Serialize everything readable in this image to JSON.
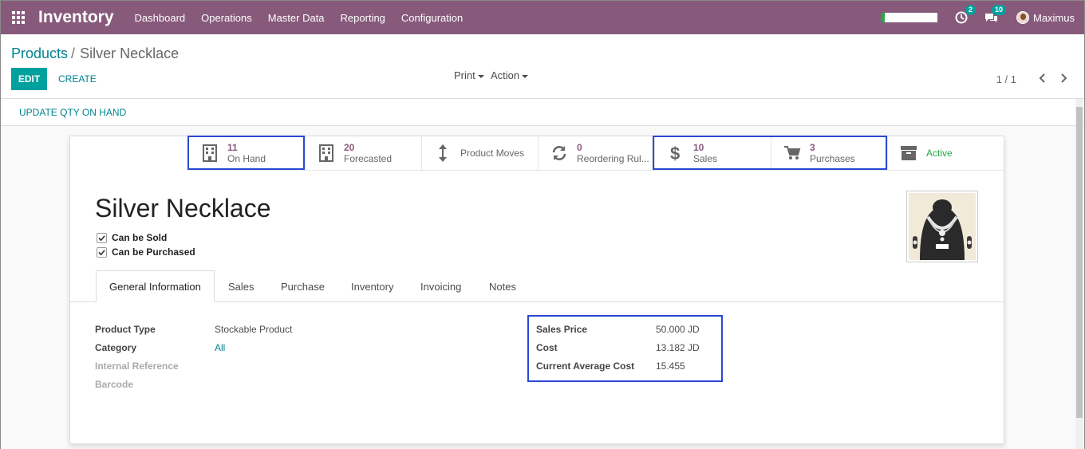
{
  "navbar": {
    "brand": "Inventory",
    "menu": [
      "Dashboard",
      "Operations",
      "Master Data",
      "Reporting",
      "Configuration"
    ],
    "activity_badge": "2",
    "messages_badge": "10",
    "user_name": "Maximus"
  },
  "breadcrumb": {
    "parent": "Products",
    "separator": "/",
    "current": "Silver Necklace"
  },
  "buttons": {
    "edit": "EDIT",
    "create": "CREATE",
    "print": "Print",
    "action": "Action",
    "update_qty": "UPDATE QTY ON HAND"
  },
  "pager": {
    "value": "1 / 1"
  },
  "smart_buttons": {
    "on_hand": {
      "value": "11",
      "label": "On Hand"
    },
    "forecasted": {
      "value": "20",
      "label": "Forecasted"
    },
    "product_moves": {
      "label": "Product Moves"
    },
    "reordering": {
      "value": "0",
      "label": "Reordering Rul..."
    },
    "sales": {
      "value": "10",
      "label": "Sales"
    },
    "purchases": {
      "value": "3",
      "label": "Purchases"
    },
    "active": {
      "label": "Active"
    }
  },
  "product": {
    "name": "Silver Necklace",
    "can_be_sold_label": "Can be Sold",
    "can_be_purchased_label": "Can be Purchased"
  },
  "tabs": [
    "General Information",
    "Sales",
    "Purchase",
    "Inventory",
    "Invoicing",
    "Notes"
  ],
  "fields": {
    "product_type_label": "Product Type",
    "product_type_value": "Stockable Product",
    "category_label": "Category",
    "category_value": "All",
    "internal_ref_label": "Internal Reference",
    "barcode_label": "Barcode",
    "sales_price_label": "Sales Price",
    "sales_price_value": "50.000 JD",
    "cost_label": "Cost",
    "cost_value": "13.182 JD",
    "avg_cost_label": "Current Average Cost",
    "avg_cost_value": "15.455"
  },
  "colors": {
    "navbar": "#875a7b",
    "accent": "#00a09d",
    "link": "#00838f",
    "highlight": "#2a49d4",
    "active": "#28a745"
  }
}
